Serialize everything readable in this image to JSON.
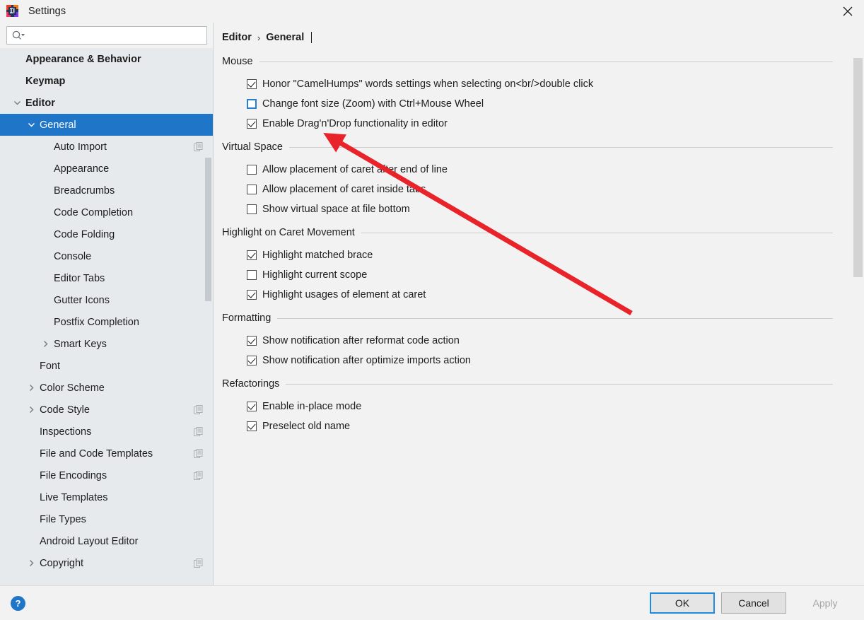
{
  "window": {
    "title": "Settings",
    "logo_icon": "intellij-idea-logo",
    "close_icon": "close-icon"
  },
  "sidebar": {
    "search": {
      "value": "",
      "placeholder": "",
      "icon": "search-icon",
      "dropdown_icon": "chevron-down-icon"
    },
    "items": [
      {
        "label": "Appearance & Behavior",
        "level": 0,
        "bold": true,
        "arrow": "none",
        "badge": false,
        "selected": false
      },
      {
        "label": "Keymap",
        "level": 0,
        "bold": true,
        "arrow": "none",
        "badge": false,
        "selected": false
      },
      {
        "label": "Editor",
        "level": 0,
        "bold": true,
        "arrow": "expanded",
        "badge": false,
        "selected": false
      },
      {
        "label": "General",
        "level": 1,
        "bold": false,
        "arrow": "expanded",
        "badge": false,
        "selected": true
      },
      {
        "label": "Auto Import",
        "level": 2,
        "bold": false,
        "arrow": "none",
        "badge": true,
        "selected": false
      },
      {
        "label": "Appearance",
        "level": 2,
        "bold": false,
        "arrow": "none",
        "badge": false,
        "selected": false
      },
      {
        "label": "Breadcrumbs",
        "level": 2,
        "bold": false,
        "arrow": "none",
        "badge": false,
        "selected": false
      },
      {
        "label": "Code Completion",
        "level": 2,
        "bold": false,
        "arrow": "none",
        "badge": false,
        "selected": false
      },
      {
        "label": "Code Folding",
        "level": 2,
        "bold": false,
        "arrow": "none",
        "badge": false,
        "selected": false
      },
      {
        "label": "Console",
        "level": 2,
        "bold": false,
        "arrow": "none",
        "badge": false,
        "selected": false
      },
      {
        "label": "Editor Tabs",
        "level": 2,
        "bold": false,
        "arrow": "none",
        "badge": false,
        "selected": false
      },
      {
        "label": "Gutter Icons",
        "level": 2,
        "bold": false,
        "arrow": "none",
        "badge": false,
        "selected": false
      },
      {
        "label": "Postfix Completion",
        "level": 2,
        "bold": false,
        "arrow": "none",
        "badge": false,
        "selected": false
      },
      {
        "label": "Smart Keys",
        "level": 2,
        "bold": false,
        "arrow": "collapsed",
        "badge": false,
        "selected": false
      },
      {
        "label": "Font",
        "level": 1,
        "bold": false,
        "arrow": "none",
        "badge": false,
        "selected": false
      },
      {
        "label": "Color Scheme",
        "level": 1,
        "bold": false,
        "arrow": "collapsed",
        "badge": false,
        "selected": false
      },
      {
        "label": "Code Style",
        "level": 1,
        "bold": false,
        "arrow": "collapsed",
        "badge": true,
        "selected": false
      },
      {
        "label": "Inspections",
        "level": 1,
        "bold": false,
        "arrow": "none",
        "badge": true,
        "selected": false
      },
      {
        "label": "File and Code Templates",
        "level": 1,
        "bold": false,
        "arrow": "none",
        "badge": true,
        "selected": false
      },
      {
        "label": "File Encodings",
        "level": 1,
        "bold": false,
        "arrow": "none",
        "badge": true,
        "selected": false
      },
      {
        "label": "Live Templates",
        "level": 1,
        "bold": false,
        "arrow": "none",
        "badge": false,
        "selected": false
      },
      {
        "label": "File Types",
        "level": 1,
        "bold": false,
        "arrow": "none",
        "badge": false,
        "selected": false
      },
      {
        "label": "Android Layout Editor",
        "level": 1,
        "bold": false,
        "arrow": "none",
        "badge": false,
        "selected": false
      },
      {
        "label": "Copyright",
        "level": 1,
        "bold": false,
        "arrow": "collapsed",
        "badge": true,
        "selected": false
      }
    ]
  },
  "breadcrumb": {
    "root": "Editor",
    "separator": "›",
    "current": "General"
  },
  "groups": [
    {
      "title": "Mouse",
      "options": [
        {
          "label": "Honor \"CamelHumps\" words settings when selecting on<br/>double click",
          "checked": true,
          "focused": false
        },
        {
          "label": "Change font size (Zoom) with Ctrl+Mouse Wheel",
          "checked": false,
          "focused": true
        },
        {
          "label": "Enable Drag'n'Drop functionality in editor",
          "checked": true,
          "focused": false
        }
      ]
    },
    {
      "title": "Virtual Space",
      "options": [
        {
          "label": "Allow placement of caret after end of line",
          "checked": false,
          "focused": false
        },
        {
          "label": "Allow placement of caret inside tabs",
          "checked": false,
          "focused": false
        },
        {
          "label": "Show virtual space at file bottom",
          "checked": false,
          "focused": false
        }
      ]
    },
    {
      "title": "Highlight on Caret Movement",
      "options": [
        {
          "label": "Highlight matched brace",
          "checked": true,
          "focused": false
        },
        {
          "label": "Highlight current scope",
          "checked": false,
          "focused": false
        },
        {
          "label": "Highlight usages of element at caret",
          "checked": true,
          "focused": false
        }
      ]
    },
    {
      "title": "Formatting",
      "options": [
        {
          "label": "Show notification after reformat code action",
          "checked": true,
          "focused": false
        },
        {
          "label": "Show notification after optimize imports action",
          "checked": true,
          "focused": false
        }
      ]
    },
    {
      "title": "Refactorings",
      "options": [
        {
          "label": "Enable in-place mode",
          "checked": true,
          "focused": false
        },
        {
          "label": "Preselect old name",
          "checked": true,
          "focused": false
        }
      ]
    }
  ],
  "footer": {
    "help_label": "?",
    "help_icon": "help-circle-icon",
    "ok_label": "OK",
    "cancel_label": "Cancel",
    "apply_label": "Apply",
    "apply_enabled": false
  },
  "annotation": {
    "type": "arrow",
    "color": "#e8232a",
    "target": "Change font size (Zoom) with Ctrl+Mouse Wheel"
  },
  "colors": {
    "selection": "#1f76c8",
    "focus": "#1f8ae0",
    "sidebar_bg": "#e6eaed",
    "content_bg": "#f2f2f2",
    "annotation_red": "#e8232a"
  }
}
